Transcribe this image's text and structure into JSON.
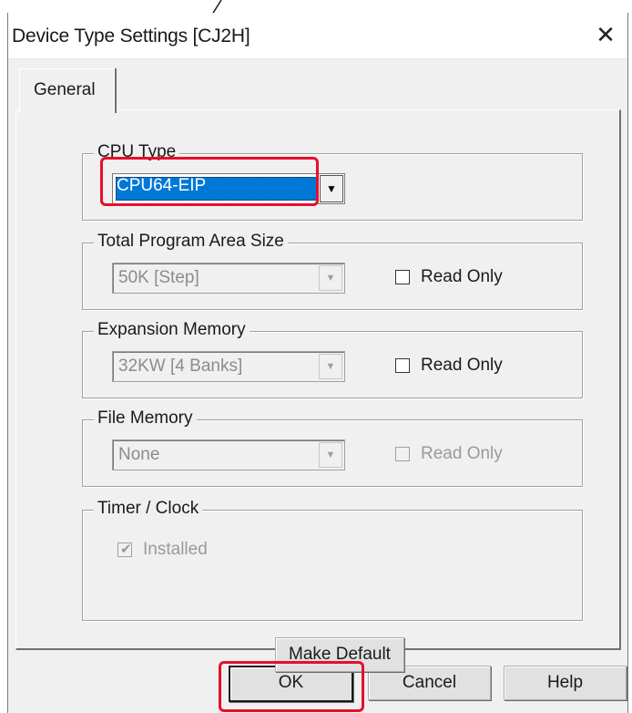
{
  "window": {
    "title": "Device Type Settings [CJ2H]",
    "close_glyph": "✕"
  },
  "tabs": [
    {
      "label": "General",
      "selected": true
    }
  ],
  "groups": {
    "cpu_type": {
      "label": "CPU Type",
      "value": "CPU64-EIP",
      "highlighted": true
    },
    "program_area": {
      "label": "Total Program Area Size",
      "value": "50K [Step]",
      "read_only_label": "Read Only",
      "read_only_checked": false
    },
    "expansion_memory": {
      "label": "Expansion Memory",
      "value": "32KW [4 Banks]",
      "read_only_label": "Read Only",
      "read_only_checked": false
    },
    "file_memory": {
      "label": "File Memory",
      "value": "None",
      "read_only_label": "Read Only",
      "read_only_checked": false,
      "disabled": true
    },
    "timer_clock": {
      "label": "Timer / Clock",
      "installed_label": "Installed",
      "installed_checked": true,
      "disabled": true
    }
  },
  "buttons": {
    "make_default": "Make Default",
    "ok": "OK",
    "cancel": "Cancel",
    "help": "Help"
  },
  "colors": {
    "highlight": "#e5102a",
    "selection": "#0078d7",
    "dialog_face": "#f0f0f0"
  },
  "icons": {
    "dropdown": "chevron-down-icon",
    "close": "close-icon",
    "check": "checkmark-icon"
  }
}
